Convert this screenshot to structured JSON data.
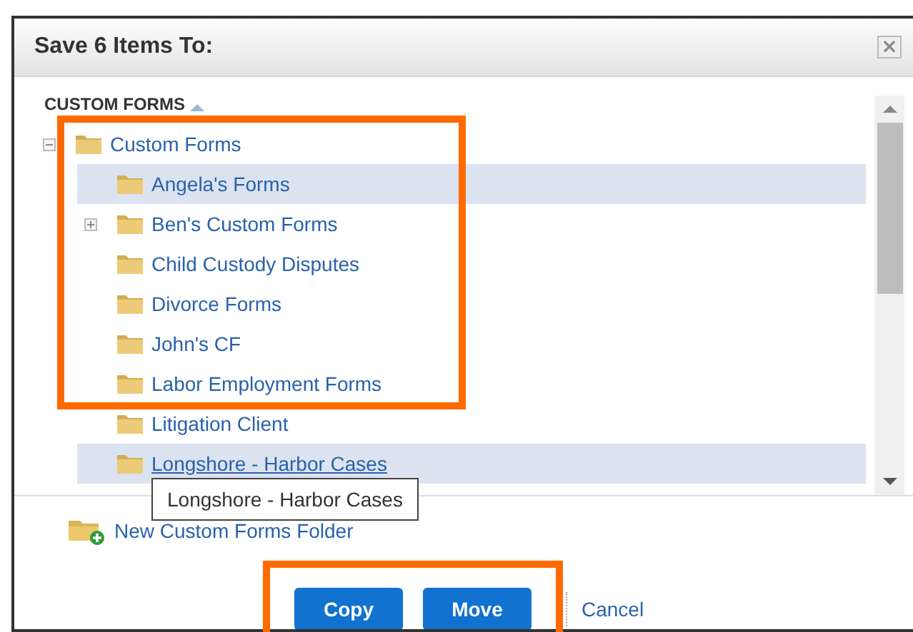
{
  "window": {
    "title": "Save 6 Items To:",
    "close": "×"
  },
  "tree": {
    "header": "CUSTOM FORMS",
    "sort_ascending": true,
    "root": {
      "label": "Custom Forms",
      "expanded": true,
      "selected": false,
      "hovered": false,
      "children": [
        {
          "label": "Angela's Forms",
          "selected": true,
          "hovered": false
        },
        {
          "label": "Ben's Custom Forms",
          "expanded": false,
          "selected": false,
          "hovered": false
        },
        {
          "label": "Child Custody Disputes",
          "selected": false,
          "hovered": false
        },
        {
          "label": "Divorce Forms",
          "selected": false,
          "hovered": false
        },
        {
          "label": "John's CF",
          "selected": false,
          "hovered": false
        },
        {
          "label": "Labor Employment Forms",
          "selected": false,
          "hovered": false
        },
        {
          "label": "Litigation Client",
          "selected": false,
          "hovered": false
        },
        {
          "label": "Longshore - Harbor Cases",
          "selected": true,
          "hovered": true
        }
      ]
    }
  },
  "tooltip": "Longshore - Harbor Cases",
  "new_folder_link": "New Custom Forms Folder",
  "buttons": [
    {
      "label": "Copy",
      "kind": "primary"
    },
    {
      "label": "Move",
      "kind": "primary"
    },
    {
      "label": "Cancel",
      "kind": "link"
    }
  ],
  "annotations": [
    {
      "kind": "highlight-box",
      "color": "#ff6a00"
    },
    {
      "kind": "highlight-box",
      "color": "#ff6a00"
    }
  ]
}
